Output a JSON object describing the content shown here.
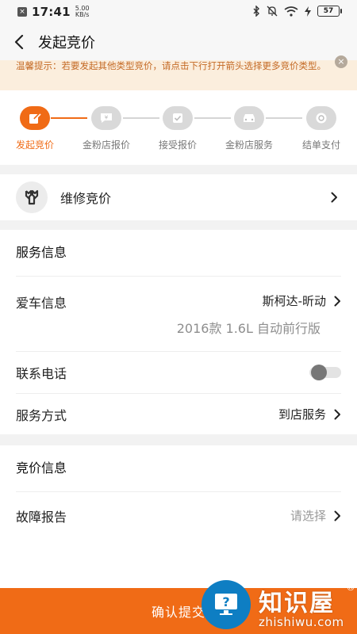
{
  "status_bar": {
    "time": "17:41",
    "speed_value": "5.00",
    "speed_unit": "KB/s",
    "battery": "57"
  },
  "header": {
    "title": "发起竞价"
  },
  "tip": {
    "text": "温馨提示：若要发起其他类型竞价，请点击下行打开箭头选择更多竞价类型。"
  },
  "steps": [
    {
      "label": "发起竞价",
      "active": true,
      "icon": "edit-icon"
    },
    {
      "label": "金粉店报价",
      "active": false,
      "icon": "price-bubble-icon"
    },
    {
      "label": "接受报价",
      "active": false,
      "icon": "checkbox-icon"
    },
    {
      "label": "金粉店服务",
      "active": false,
      "icon": "car-icon"
    },
    {
      "label": "结单支付",
      "active": false,
      "icon": "payment-icon"
    }
  ],
  "repair": {
    "label": "维修竞价",
    "icon": "wrench-icon"
  },
  "service_info": {
    "title": "服务信息",
    "car_label": "爱车信息",
    "car_value": "斯柯达-昕动",
    "car_sub": "2016款 1.6L 自动前行版",
    "phone_label": "联系电话",
    "method_label": "服务方式",
    "method_value": "到店服务"
  },
  "bid_info": {
    "title": "竞价信息",
    "fault_label": "故障报告",
    "fault_placeholder": "请选择"
  },
  "submit": {
    "label": "确认提交"
  },
  "watermark": {
    "name": "知识屋",
    "domain": "zhishiwu.com",
    "reg": "®"
  },
  "colors": {
    "accent": "#f06b16",
    "tip_bg": "#fbeedd",
    "tip_text": "#c46a25"
  }
}
